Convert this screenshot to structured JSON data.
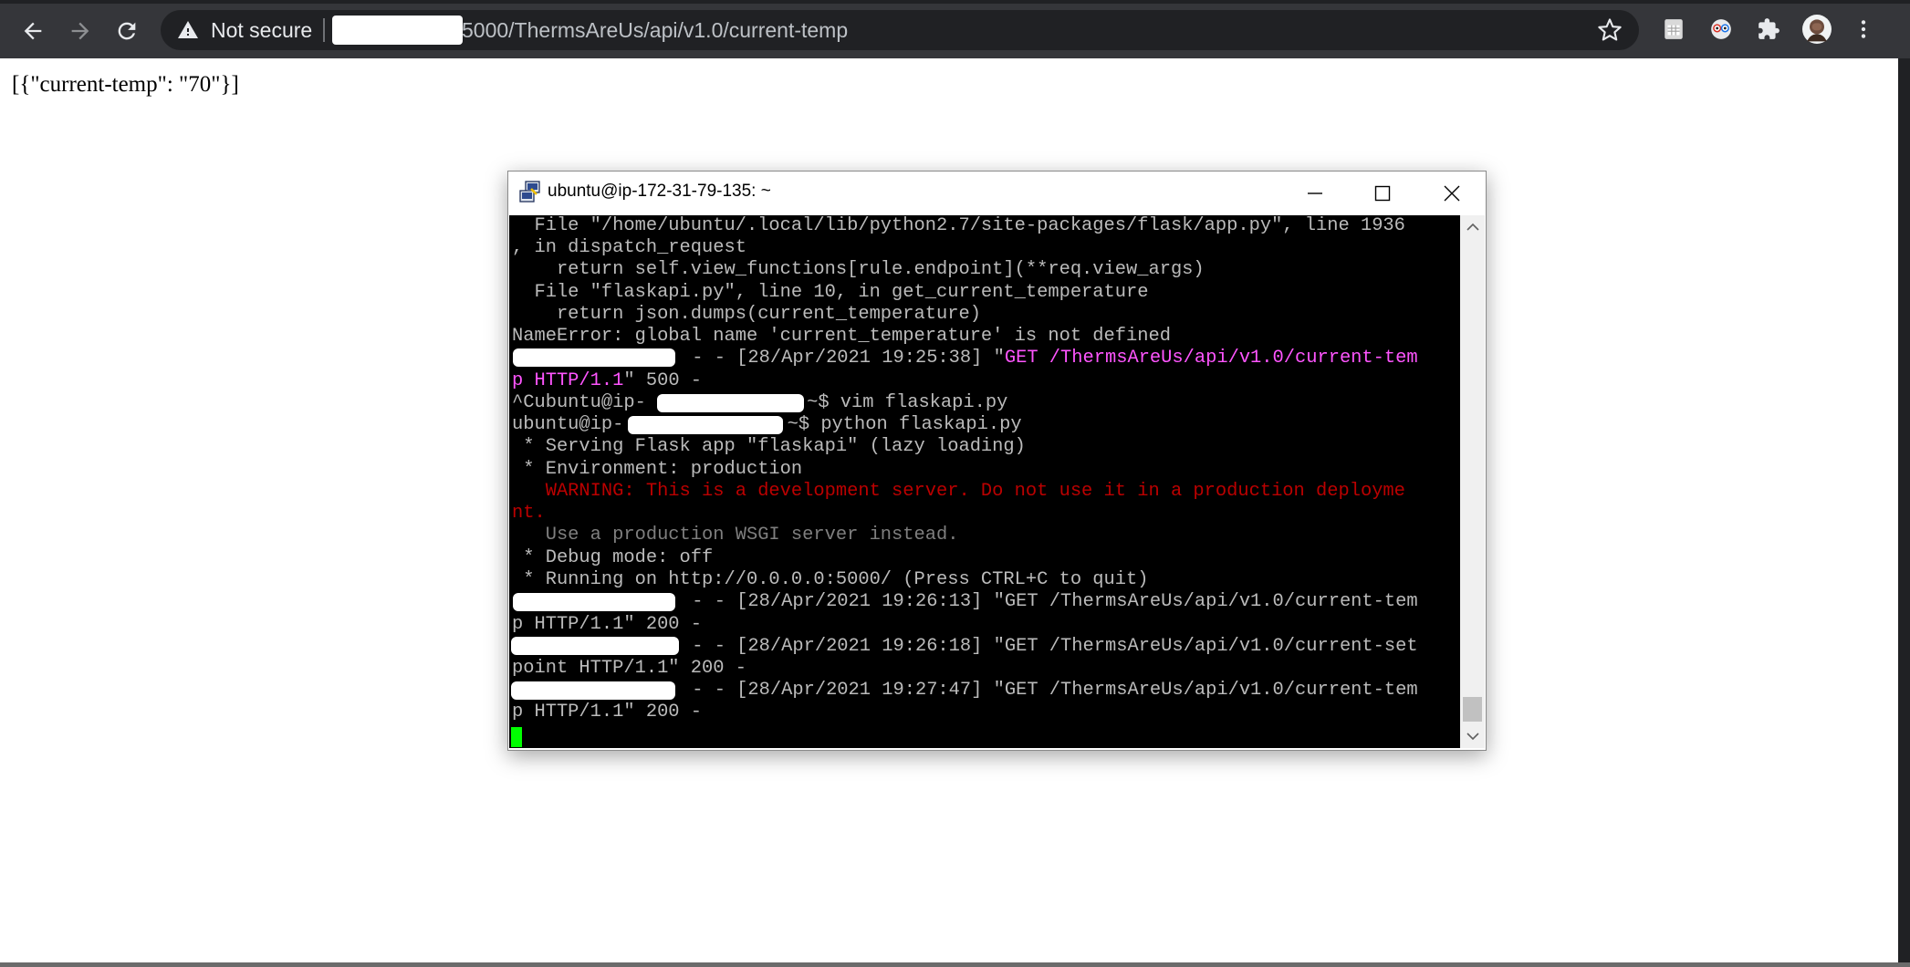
{
  "browser": {
    "security_label": "Not secure",
    "url_visible": "5000/ThermsAreUs/api/v1.0/current-temp",
    "icons": [
      "back-arrow-icon",
      "forward-arrow-icon",
      "reload-icon",
      "warning-icon",
      "star-icon",
      "sheets-extension-icon",
      "eyes-extension-icon",
      "puzzle-icon",
      "avatar",
      "more-vert-icon"
    ]
  },
  "page": {
    "body_text": "[{\"current-temp\": \"70\"}]"
  },
  "terminal": {
    "window_title": "ubuntu@ip-172-31-79-135: ~",
    "lines": [
      "  File \"/home/ubuntu/.local/lib/python2.7/site-packages/flask/app.py\", line 1936",
      ", in dispatch_request",
      "    return self.view_functions[rule.endpoint](**req.view_args)",
      "  File \"flaskapi.py\", line 10, in get_current_temperature",
      "    return json.dumps(current_temperature)",
      "NameError: global name 'current_temperature' is not defined",
      " - - [28/Apr/2021 19:25:38] \"",
      "GET /ThermsAreUs/api/v1.0/current-tem",
      "p HTTP/1.1",
      "\" 500 -",
      "^Cubuntu@ip-",
      ":~$ vim flaskapi.py",
      "ubuntu@ip-",
      ":~$ python flaskapi.py",
      " * Serving Flask app \"flaskapi\" (lazy loading)",
      " * Environment: production",
      "   WARNING: This is a development server. Do not use it in a production deployme",
      "nt.",
      "   Use a production WSGI server instead.",
      " * Debug mode: off",
      " * Running on http://0.0.0.0:5000/ (Press CTRL+C to quit)",
      " - - [28/Apr/2021 19:26:13] \"GET /ThermsAreUs/api/v1.0/current-tem",
      "p HTTP/1.1\" 200 -",
      " - - [28/Apr/2021 19:26:18] \"GET /ThermsAreUs/api/v1.0/current-set",
      "point HTTP/1.1\" 200 -",
      " - - [28/Apr/2021 19:27:47] \"GET /ThermsAreUs/api/v1.0/current-tem",
      "p HTTP/1.1\" 200 -"
    ],
    "colors": {
      "default": "#bbbbbb",
      "highlight": "#ff55ff",
      "warning": "#bb0000",
      "dim": "#7f7f7f",
      "cursor": "#00ff00"
    }
  }
}
